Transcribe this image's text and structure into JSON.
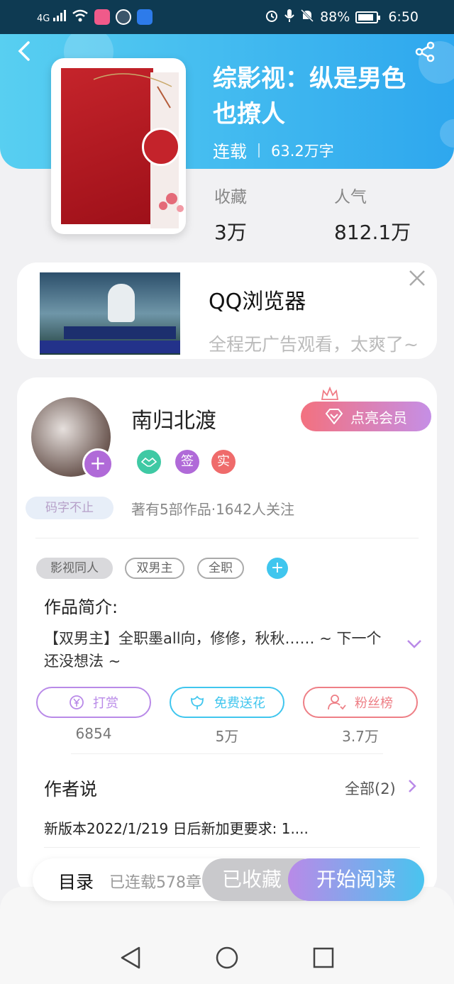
{
  "status_bar": {
    "signal": "4G",
    "battery": "88%",
    "time": "6:50"
  },
  "book": {
    "title": "综影视：纵是男色也撩人",
    "status": "连载",
    "word_count": "63.2万字",
    "stats": [
      {
        "label": "收藏",
        "value": "3万"
      },
      {
        "label": "人气",
        "value": "812.1万"
      }
    ]
  },
  "ad": {
    "title": "QQ浏览器",
    "description": "全程无广告观看，太爽了~"
  },
  "author": {
    "name": "南归北渡",
    "typing_badge": "码字不止",
    "vip_button": "点亮会员",
    "badges": [
      {
        "label": "签"
      },
      {
        "label": "实"
      }
    ],
    "meta": "著有5部作品·1642人关注"
  },
  "tags": [
    {
      "label": "影视同人"
    },
    {
      "label": "双男主"
    },
    {
      "label": "全职"
    }
  ],
  "intro": {
    "label": "作品简介:",
    "text": "【双男主】全职墨all向，修修，秋秋…… ~ 下一个还没想法 ~"
  },
  "actions": [
    {
      "label": "打赏",
      "count": "6854",
      "color": "#b98ae8"
    },
    {
      "label": "免费送花",
      "count": "5万",
      "color": "#40c6ee"
    },
    {
      "label": "粉丝榜",
      "count": "3.7万",
      "color": "#ee7f86"
    }
  ],
  "author_says": {
    "label": "作者说",
    "all_label": "全部(2)",
    "text": "新版本2022/1/219 日后新加更要求:   1...."
  },
  "bottom_bar": {
    "toc": "目录",
    "toc_info": "已连载578章",
    "collected": "已收藏",
    "read": "开始阅读"
  },
  "colors": {
    "header_start": "#58cff1",
    "header_end": "#2ea7ee",
    "accent_purple": "#b06ad8"
  }
}
